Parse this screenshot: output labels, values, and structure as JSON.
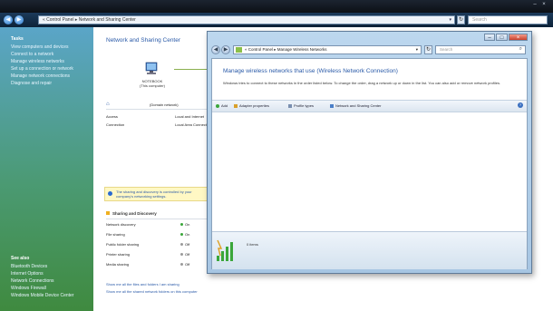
{
  "outer": {
    "breadcrumb": "« Control Panel ▸ Network and Sharing Center",
    "search_placeholder": "Search"
  },
  "taskpane": {
    "heading": "Tasks",
    "items": [
      "View computers and devices",
      "Connect to a network",
      "Manage wireless networks",
      "Set up a connection or network",
      "Manage network connections",
      "Diagnose and repair"
    ],
    "see_also_heading": "See also",
    "see_also": [
      "Bluetooth Devices",
      "Internet Options",
      "Network Connections",
      "Windows Firewall",
      "Windows Mobile Device Center"
    ]
  },
  "main": {
    "title": "Network and Sharing Center",
    "computer_name": "NOTEBOOK",
    "computer_sub": "(This computer)",
    "network_label": "(Domain network)",
    "rows": [
      {
        "label": "Access",
        "value": "Local and Internet"
      },
      {
        "label": "Connection",
        "value": "Local Area Connection"
      }
    ],
    "notice": "The sharing and discovery is controlled by your company's networking settings.",
    "sharing_heading": "Sharing and Discovery",
    "sharing": [
      {
        "label": "Network discovery",
        "status": "On"
      },
      {
        "label": "File sharing",
        "status": "On"
      },
      {
        "label": "Public folder sharing",
        "status": "Off"
      },
      {
        "label": "Printer sharing",
        "status": "Off"
      },
      {
        "label": "Media sharing",
        "status": "Off"
      }
    ],
    "links": [
      "Show me all the files and folders I am sharing",
      "Show me all the shared network folders on this computer"
    ]
  },
  "dialog": {
    "breadcrumb": "« Control Panel ▸ Manage Wireless Networks",
    "search_placeholder": "Search",
    "title": "Manage wireless networks that use (Wireless Network Connection)",
    "description": "Windows tries to connect to these networks in the order listed below. To change the order, drag a network up or down in the list. You can also add or remove network profiles.",
    "toolbar": {
      "add": "Add",
      "adapter": "Adapter properties",
      "profile": "Profile types",
      "center": "Network and Sharing Center"
    },
    "items_count": "0 items"
  },
  "colors": {
    "link": "#2a5aa8",
    "on": "#3aa63a",
    "off": "#9a9a9a"
  }
}
